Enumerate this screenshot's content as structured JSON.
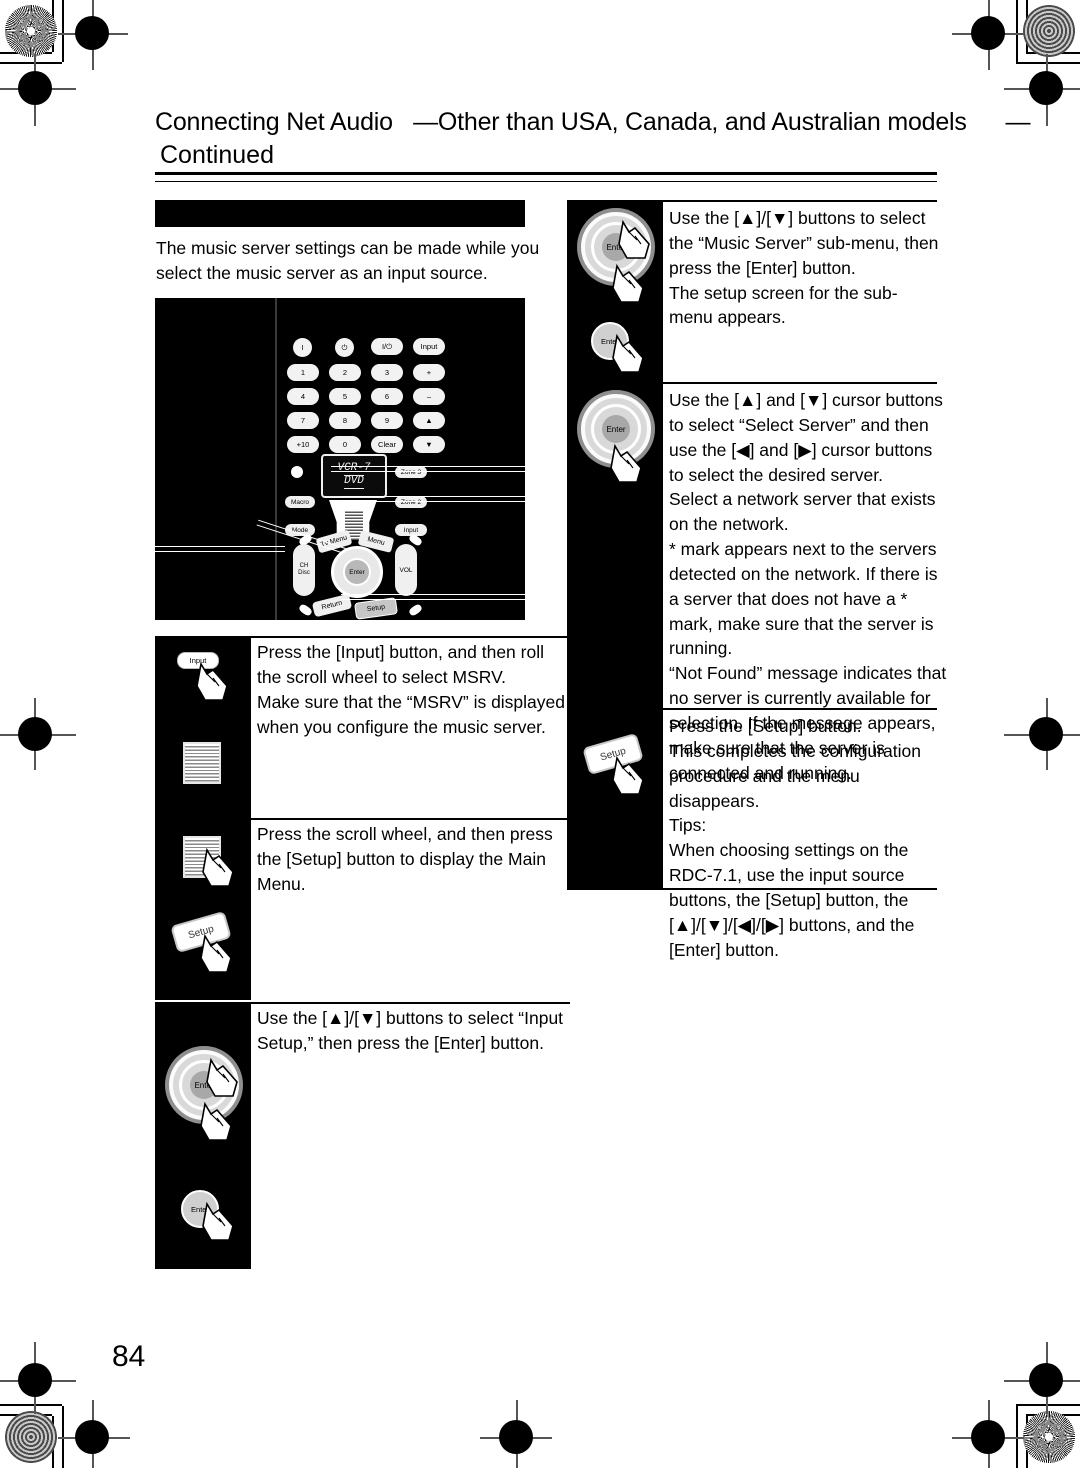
{
  "document": {
    "page_number": "84",
    "header": {
      "title": "Connecting Net Audio",
      "subtitle": "—Other than USA, Canada, and Australian models",
      "dash_end": "—",
      "continued": "Continued"
    },
    "intro": "The music server settings can be made while you select the music server as an input source."
  },
  "remote": {
    "label": "remote-control-illustration",
    "lcd_line1": "VCR-7",
    "lcd_line2": "DVD",
    "top_keys": [
      "I",
      "⏻",
      "I/⏻",
      "Input"
    ],
    "keypad_rows": [
      [
        "1",
        "2",
        "3",
        "+"
      ],
      [
        "4",
        "5",
        "6",
        "–"
      ],
      [
        "7",
        "8",
        "9",
        "▲"
      ],
      [
        "+10",
        "0",
        "Clear",
        "▼"
      ]
    ],
    "side_keys": [
      "Macro",
      "Mode",
      "Zone 3",
      "Zone 2",
      "Input"
    ],
    "menu_keys": [
      "Tv Menu",
      "Menu"
    ],
    "nav_center": "Enter",
    "left_rocker": "CH\nDisc",
    "right_rocker": "VOL",
    "bottom_keys": [
      "Return",
      "Setup"
    ]
  },
  "left_steps": [
    {
      "icons": [
        "input-button-icon",
        "scroll-wheel-icon"
      ],
      "icon_labels": {
        "input": "Input"
      },
      "text": "Press the [Input] button, and then roll the scroll wheel to select MSRV.\nMake sure that the “MSRV” is displayed when you configure the music server."
    },
    {
      "icons": [
        "scroll-wheel-icon",
        "setup-button-icon"
      ],
      "icon_labels": {
        "setup": "Setup"
      },
      "text": "Press the scroll wheel, and then press the [Setup] button to display the Main Menu."
    },
    {
      "icons": [
        "enter-wheel-icon",
        "enter-button-icon"
      ],
      "icon_labels": {
        "enter": "Enter"
      },
      "text": "Use the [▲]/[▼] buttons to select “Input Setup,” then press the [Enter] button."
    }
  ],
  "right_steps": [
    {
      "icons": [
        "enter-wheel-icon",
        "enter-button-icon"
      ],
      "icon_labels": {
        "enter": "Enter"
      },
      "text": "Use the [▲]/[▼] buttons to select the “Music Server” sub-menu, then press the [Enter] button.\nThe setup screen for the sub-menu appears."
    },
    {
      "icons": [
        "enter-wheel-icon"
      ],
      "icon_labels": {
        "enter": "Enter"
      },
      "text": "Use the [▲] and [▼] cursor buttons to select “Select Server” and then use the [◀] and [▶] cursor buttons to select the desired server.\nSelect a network server that exists on the network.\n* mark appears next to the servers detected on the network. If there is a server that does not have a * mark, make sure that the server is running.\n“Not Found” message indicates that no server is currently available for selection. If the message appears, make sure that the server is connected and running."
    },
    {
      "icons": [
        "setup-button-icon"
      ],
      "icon_labels": {
        "setup": "Setup"
      },
      "text": "Press the [Setup] button.\nThis completes the configuration procedure and the menu disappears.\nTips:\nWhen choosing settings on the RDC-7.1, use the input source buttons, the [Setup] button, the [▲]/[▼]/[◀]/[▶] buttons, and the [Enter] button."
    }
  ],
  "print_marks": {
    "top_left_target": "starburst-resolution-target",
    "top_right_target": "concentric-ring-target",
    "bottom_left_target": "concentric-ring-target",
    "bottom_right_target": "starburst-resolution-target"
  }
}
